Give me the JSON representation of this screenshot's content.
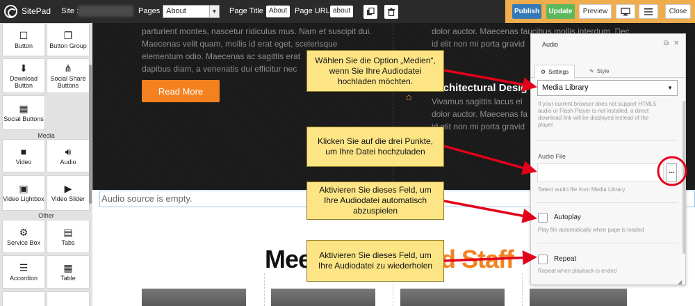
{
  "topbar": {
    "app_name": "SitePad",
    "site_label": "Site :",
    "pages_label": "Pages :",
    "pages_selected": "About",
    "page_title_label": "Page Title :",
    "page_title_value": "About",
    "page_url_label": "Page URL :",
    "page_url_value": "about",
    "publish_label": "Publish",
    "update_label": "Update",
    "preview_label": "Preview",
    "close_label": "Close",
    "icons": [
      "copy-icon",
      "trash-icon",
      "desktop-icon",
      "menu-icon"
    ],
    "colors": {
      "bar": "#2b2b2b",
      "actions_bg": "#f0ad4e",
      "publish": "#337ab7",
      "update": "#5cb85c"
    }
  },
  "sidebar": {
    "widgets": [
      {
        "label": "Button",
        "icon": "square-icon"
      },
      {
        "label": "Button Group",
        "icon": "copy-icon"
      },
      {
        "label": "Download Button",
        "icon": "download-icon"
      },
      {
        "label": "Social Share Buttons",
        "icon": "share-icon"
      },
      {
        "label": "Social Buttons",
        "icon": "social-grid-icon"
      },
      {
        "label": "Video",
        "icon": "video-camera-icon"
      },
      {
        "label": "Audio",
        "icon": "speaker-icon"
      },
      {
        "label": "Video Lightbox",
        "icon": "film-icon"
      },
      {
        "label": "Video Slider",
        "icon": "video-slider-icon"
      },
      {
        "label": "Service Box",
        "icon": "gear-icon"
      },
      {
        "label": "Tabs",
        "icon": "tabs-icon"
      },
      {
        "label": "Accordion",
        "icon": "accordion-icon"
      },
      {
        "label": "Table",
        "icon": "table-icon"
      }
    ],
    "categories": {
      "media": "Media",
      "other": "Other"
    }
  },
  "canvas": {
    "left_paragraph": [
      "parturient montes, nascetur ridiculus mus. Nam et suscipit dui.",
      "Maecenas velit quam, mollis id erat eget, scelerisque",
      "elementum odio. Maecenas ac sagittis erat",
      "dapibus diam, a venenatis dui efficitur nec"
    ],
    "right_paragraph_top": [
      "dolor auctor. Maecenas faucibus mollis interdum. Dec",
      "id elit non mi porta gravid",
      "a."
    ],
    "right_heading": "Architectural Desig",
    "right_paragraph_bottom": [
      "Vivamus sagittis lacus el",
      "dolor auctor. Maecenas fa",
      "id elit non mi porta gravid",
      "a."
    ],
    "read_more_label": "Read More",
    "audio_placeholder": "Audio source is empty.",
    "staff_heading_black": "Mee",
    "staff_heading_orange": "ed Staff"
  },
  "audio_panel": {
    "title": "Audio",
    "tab_settings": "Settings",
    "tab_style": "Style",
    "source_select": "Media Library",
    "source_help": [
      "If your current browser does not support HTML5",
      "audio or Flash Player is not installed, a direct",
      "download link will be displayed instead of the",
      "player"
    ],
    "file_label": "Audio File",
    "file_button": "...",
    "file_help": "Select audio file from Media Library",
    "autoplay_label": "Autoplay",
    "autoplay_help": "Play file automatically when page is loaded",
    "autoplay_checked": false,
    "repeat_label": "Repeat",
    "repeat_help": "Repeat when playback is ended",
    "repeat_checked": false
  },
  "callouts": [
    "Wählen Sie die Option „Medien“, wenn Sie Ihre Audiodatei hochladen möchten.",
    "Klicken Sie auf die drei Punkte, um Ihre Datei hochzuladen",
    "Aktivieren Sie dieses Feld, um Ihre Audiodatei automatisch abzuspielen",
    "Aktivieren Sie dieses Feld, um Ihre Audiodatei zu wiederholen"
  ],
  "annotation_colors": {
    "callout_bg": "#fde585",
    "arrow": "#e3001b",
    "highlight_ring": "#e3001b"
  }
}
